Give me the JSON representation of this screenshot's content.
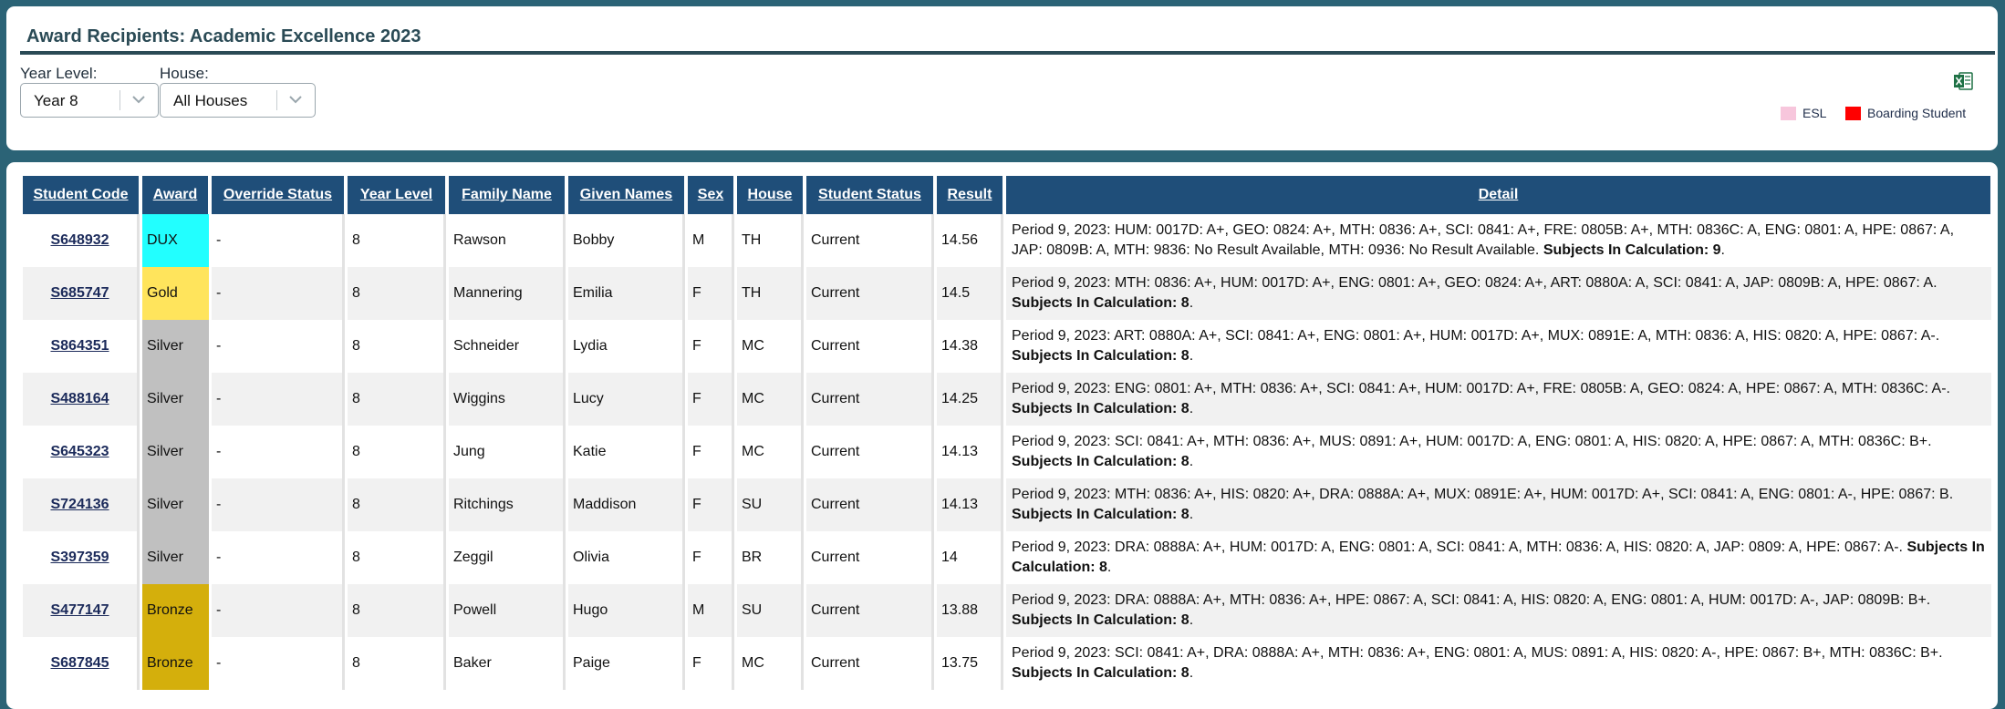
{
  "header": {
    "title": "Award Recipients: Academic Excellence 2023",
    "year_level_label": "Year Level:",
    "year_level_value": "Year 8",
    "house_label": "House:",
    "house_value": "All Houses",
    "excel_icon": "excel-export-icon",
    "legend": [
      {
        "label": "ESL",
        "color": "#f7c6dc"
      },
      {
        "label": "Boarding Student",
        "color": "#ff0000"
      }
    ]
  },
  "table": {
    "columns": [
      "Student Code",
      "Award",
      "Override Status",
      "Year Level",
      "Family Name",
      "Given Names",
      "Sex",
      "House",
      "Student Status",
      "Result",
      "Detail"
    ],
    "award_colors": {
      "DUX": "#22ffff",
      "Gold": "#ffe45c",
      "Silver": "#c0c0c0",
      "Bronze": "#d4af0c"
    },
    "rows": [
      {
        "code": "S648932",
        "award": "DUX",
        "override": "-",
        "year": "8",
        "family": "Rawson",
        "given": "Bobby",
        "sex": "M",
        "house": "TH",
        "status": "Current",
        "result": "14.56",
        "detail": "Period 9, 2023: HUM: 0017D: A+, GEO: 0824: A+, MTH: 0836: A+, SCI: 0841: A+, FRE: 0805B: A+, MTH: 0836C: A, ENG: 0801: A, HPE: 0867: A, JAP: 0809B: A, MTH: 9836: No Result Available, MTH: 0936: No Result Available.",
        "subjects_label": "Subjects In Calculation: 9",
        "subjects_end": "."
      },
      {
        "code": "S685747",
        "award": "Gold",
        "override": "-",
        "year": "8",
        "family": "Mannering",
        "given": "Emilia",
        "sex": "F",
        "house": "TH",
        "status": "Current",
        "result": "14.5",
        "detail": "Period 9, 2023: MTH: 0836: A+, HUM: 0017D: A+, ENG: 0801: A+, GEO: 0824: A+, ART: 0880A: A, SCI: 0841: A, JAP: 0809B: A, HPE: 0867: A.",
        "subjects_label": "Subjects In Calculation: 8",
        "subjects_end": "."
      },
      {
        "code": "S864351",
        "award": "Silver",
        "override": "-",
        "year": "8",
        "family": "Schneider",
        "given": "Lydia",
        "sex": "F",
        "house": "MC",
        "status": "Current",
        "result": "14.38",
        "detail": "Period 9, 2023: ART: 0880A: A+, SCI: 0841: A+, ENG: 0801: A+, HUM: 0017D: A+, MUX: 0891E: A, MTH: 0836: A, HIS: 0820: A, HPE: 0867: A-.",
        "subjects_label": "Subjects In Calculation: 8",
        "subjects_end": "."
      },
      {
        "code": "S488164",
        "award": "Silver",
        "override": "-",
        "year": "8",
        "family": "Wiggins",
        "given": "Lucy",
        "sex": "F",
        "house": "MC",
        "status": "Current",
        "result": "14.25",
        "detail": "Period 9, 2023: ENG: 0801: A+, MTH: 0836: A+, SCI: 0841: A+, HUM: 0017D: A+, FRE: 0805B: A, GEO: 0824: A, HPE: 0867: A, MTH: 0836C: A-.",
        "subjects_label": "Subjects In Calculation: 8",
        "subjects_end": "."
      },
      {
        "code": "S645323",
        "award": "Silver",
        "override": "-",
        "year": "8",
        "family": "Jung",
        "given": "Katie",
        "sex": "F",
        "house": "MC",
        "status": "Current",
        "result": "14.13",
        "detail": "Period 9, 2023: SCI: 0841: A+, MTH: 0836: A+, MUS: 0891: A+, HUM: 0017D: A, ENG: 0801: A, HIS: 0820: A, HPE: 0867: A, MTH: 0836C: B+.",
        "subjects_label": "Subjects In Calculation: 8",
        "subjects_end": "."
      },
      {
        "code": "S724136",
        "award": "Silver",
        "override": "-",
        "year": "8",
        "family": "Ritchings",
        "given": "Maddison",
        "sex": "F",
        "house": "SU",
        "status": "Current",
        "result": "14.13",
        "detail": "Period 9, 2023: MTH: 0836: A+, HIS: 0820: A+, DRA: 0888A: A+, MUX: 0891E: A+, HUM: 0017D: A+, SCI: 0841: A, ENG: 0801: A-, HPE: 0867: B.",
        "subjects_label": "Subjects In Calculation: 8",
        "subjects_end": "."
      },
      {
        "code": "S397359",
        "award": "Silver",
        "override": "-",
        "year": "8",
        "family": "Zeggil",
        "given": "Olivia",
        "sex": "F",
        "house": "BR",
        "status": "Current",
        "result": "14",
        "detail": "Period 9, 2023: DRA: 0888A: A+, HUM: 0017D: A, ENG: 0801: A, SCI: 0841: A, MTH: 0836: A, HIS: 0820: A, JAP: 0809: A, HPE: 0867: A-.",
        "subjects_label": "Subjects In Calculation: 8",
        "subjects_end": "."
      },
      {
        "code": "S477147",
        "award": "Bronze",
        "override": "-",
        "year": "8",
        "family": "Powell",
        "given": "Hugo",
        "sex": "M",
        "house": "SU",
        "status": "Current",
        "result": "13.88",
        "detail": "Period 9, 2023: DRA: 0888A: A+, MTH: 0836: A+, HPE: 0867: A, SCI: 0841: A, HIS: 0820: A, ENG: 0801: A, HUM: 0017D: A-, JAP: 0809B: B+.",
        "subjects_label": "Subjects In Calculation: 8",
        "subjects_end": "."
      },
      {
        "code": "S687845",
        "award": "Bronze",
        "override": "-",
        "year": "8",
        "family": "Baker",
        "given": "Paige",
        "sex": "F",
        "house": "MC",
        "status": "Current",
        "result": "13.75",
        "detail": "Period 9, 2023: SCI: 0841: A+, DRA: 0888A: A+, MTH: 0836: A+, ENG: 0801: A, MUS: 0891: A, HIS: 0820: A-, HPE: 0867: B+, MTH: 0836C: B+.",
        "subjects_label": "Subjects In Calculation: 8",
        "subjects_end": "."
      }
    ]
  }
}
